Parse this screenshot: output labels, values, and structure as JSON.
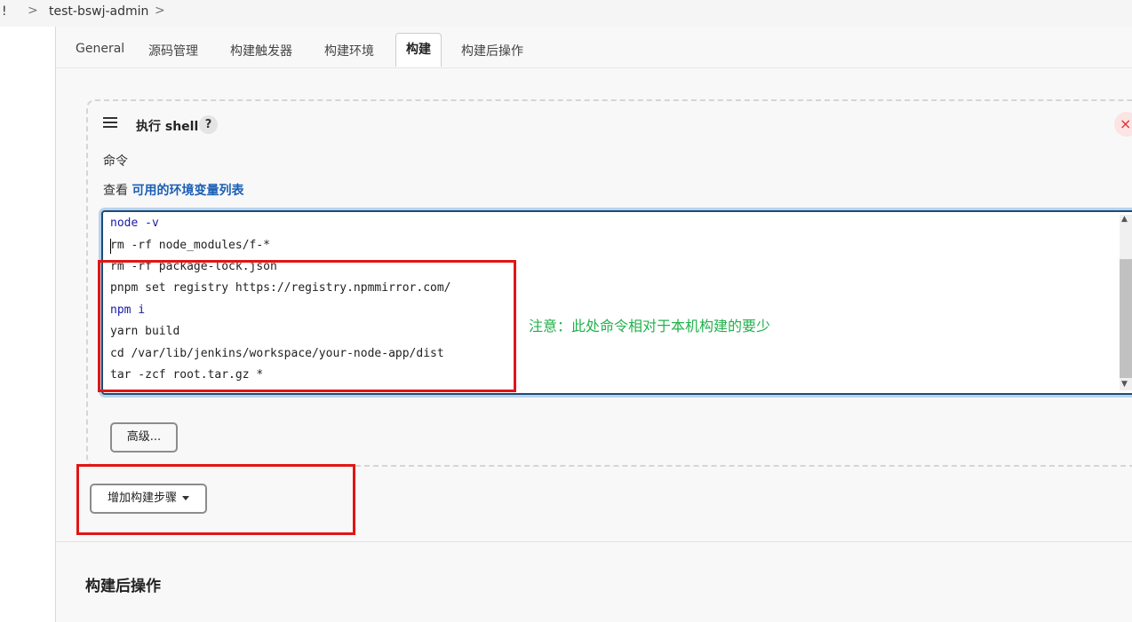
{
  "breadcrumb": {
    "prefix": "!",
    "separator": ">",
    "job": "test-bswj-admin"
  },
  "tabs": [
    {
      "label": "General"
    },
    {
      "label": "源码管理"
    },
    {
      "label": "构建触发器"
    },
    {
      "label": "构建环境"
    },
    {
      "label": "构建",
      "active": true
    },
    {
      "label": "构建后操作"
    }
  ],
  "step": {
    "title": "执行 shell",
    "help": "?",
    "close": "×",
    "command_label": "命令",
    "env_prefix": "查看 ",
    "env_link": "可用的环境变量列表",
    "advanced_button": "高级..."
  },
  "code": {
    "lines": [
      "node -v",
      "rm -rf node_modules/f-*",
      "rm -rf package-lock.json",
      "pnpm set registry https://registry.npmmirror.com/",
      "npm i",
      "yarn build",
      "cd /var/lib/jenkins/workspace/your-node-app/dist",
      "tar -zcf root.tar.gz *"
    ]
  },
  "annotation": {
    "note": "注意：此处命令相对于本机构建的要少",
    "color": "#22b14c",
    "box_color": "#e01616"
  },
  "add_step_button": "增加构建步骤",
  "post_build": {
    "title": "构建后操作"
  }
}
